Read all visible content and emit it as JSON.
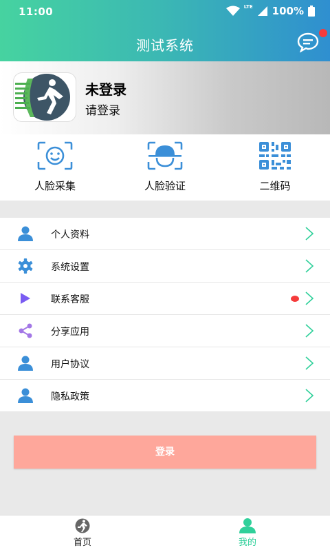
{
  "status": {
    "time": "11:00",
    "network": "LTE",
    "battery": "100%"
  },
  "header": {
    "title": "测试系统",
    "message_icon": "chat-bubble-icon",
    "has_notification": true
  },
  "profile": {
    "name": "未登录",
    "subtitle": "请登录"
  },
  "actions": [
    {
      "label": "人脸采集",
      "icon": "face-scan-icon"
    },
    {
      "label": "人脸验证",
      "icon": "face-verify-icon"
    },
    {
      "label": "二维码",
      "icon": "qr-code-icon"
    }
  ],
  "menu": [
    {
      "label": "个人资料",
      "icon": "person-icon"
    },
    {
      "label": "系统设置",
      "icon": "gear-icon"
    },
    {
      "label": "联系客服",
      "icon": "play-icon",
      "badge": true
    },
    {
      "label": "分享应用",
      "icon": "share-icon"
    },
    {
      "label": "用户协议",
      "icon": "person-icon"
    },
    {
      "label": "隐私政策",
      "icon": "person-icon"
    }
  ],
  "login_button": "登录",
  "tabs": [
    {
      "label": "首页",
      "icon": "runner-icon",
      "active": false
    },
    {
      "label": "我的",
      "icon": "person-icon",
      "active": true
    }
  ],
  "colors": {
    "accent": "#2fd09a",
    "login_button": "#fea79b",
    "icon_blue": "#3b8fd8",
    "badge_red": "#f53b3b",
    "chevron": "#2fd09a"
  }
}
